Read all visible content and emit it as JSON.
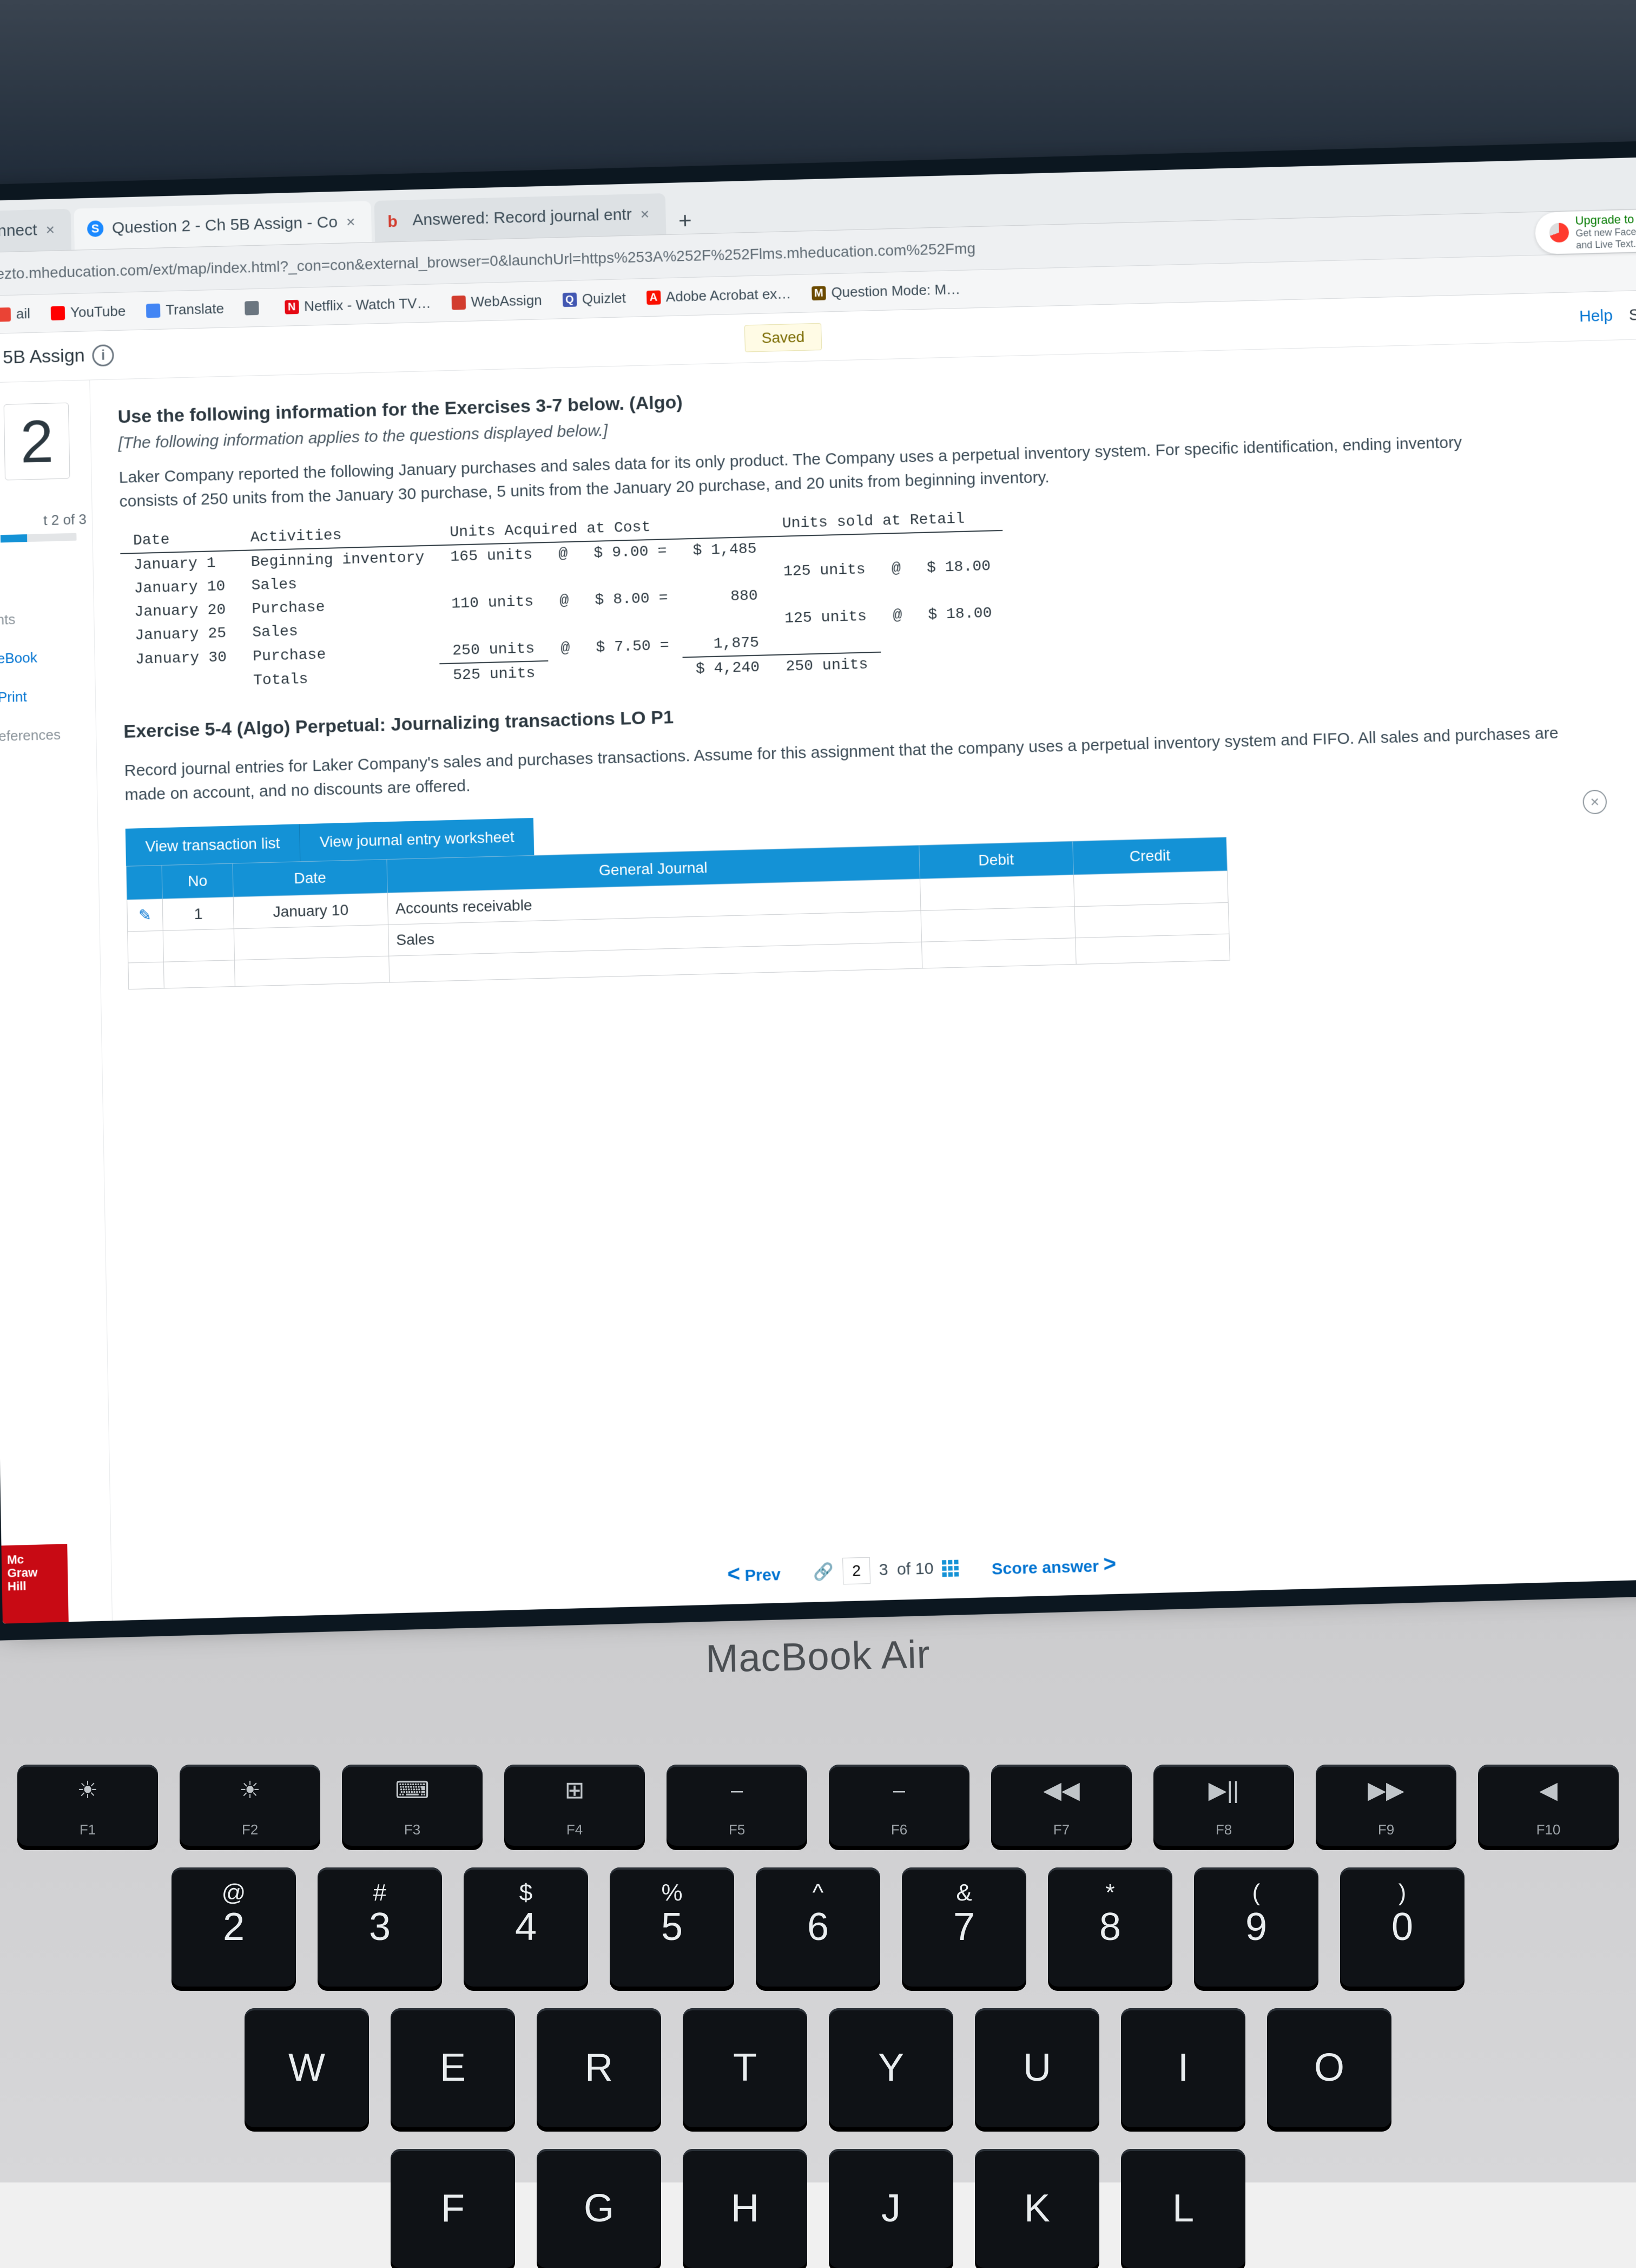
{
  "tabs": [
    {
      "label": "nnect",
      "active": false
    },
    {
      "label": "Question 2 - Ch 5B Assign - Co",
      "active": true,
      "fav": "S"
    },
    {
      "label": "Answered: Record journal entr",
      "active": false,
      "fav": "b"
    }
  ],
  "url": "ezto.mheducation.com/ext/map/index.html?_con=con&external_browser=0&launchUrl=https%253A%252F%252Flms.mheducation.com%252Fmg",
  "upgrade": {
    "title": "Upgrade to ma",
    "line1": "Get new FaceTim",
    "line2": "and Live Text."
  },
  "bookmarks": [
    {
      "label": "ail",
      "color": "#ea4335"
    },
    {
      "label": "YouTube",
      "color": "#ff0000"
    },
    {
      "label": "Translate",
      "color": "#4285f4"
    },
    {
      "label": "",
      "color": "#6b7680"
    },
    {
      "label": "Netflix - Watch TV…",
      "color": "#e50914",
      "prefix": "N"
    },
    {
      "label": "WebAssign",
      "color": "#d23c2e"
    },
    {
      "label": "Quizlet",
      "color": "#4257b2",
      "prefix": "Q"
    },
    {
      "label": "Adobe Acrobat ex…",
      "color": "#fa0f00",
      "prefix": "A"
    },
    {
      "label": "Question Mode: M…",
      "color": "#6b4a00",
      "prefix": "M"
    }
  ],
  "assign": {
    "title": "5B Assign",
    "saved": "Saved",
    "help": "Help",
    "save": "Save"
  },
  "qnum": "2",
  "part": "t 2 of 3",
  "sideLinks": [
    "nts",
    "eBook",
    "Print",
    "eferences"
  ],
  "intro": {
    "head": "Use the following information for the Exercises 3-7 below. (Algo)",
    "italic": "[The following information applies to the questions displayed below.]",
    "body": "Laker Company reported the following January purchases and sales data for its only product. The Company uses a perpetual inventory system. For specific identification, ending inventory consists of 250 units from the January 30 purchase, 5 units from the January 20 purchase, and 20 units from beginning inventory."
  },
  "dataHeaders": {
    "date": "Date",
    "act": "Activities",
    "uac": "Units Acquired at Cost",
    "usr": "Units sold at Retail"
  },
  "dataRows": [
    {
      "date": "January 1",
      "act": "Beginning inventory",
      "units": "165 units",
      "at": "@",
      "price": "$ 9.00 =",
      "ext": "$ 1,485",
      "sold": "",
      "sat": "",
      "sprice": ""
    },
    {
      "date": "January 10",
      "act": "Sales",
      "units": "",
      "at": "",
      "price": "",
      "ext": "",
      "sold": "125 units",
      "sat": "@",
      "sprice": "$ 18.00"
    },
    {
      "date": "January 20",
      "act": "Purchase",
      "units": "110 units",
      "at": "@",
      "price": "$ 8.00 =",
      "ext": "880",
      "sold": "",
      "sat": "",
      "sprice": ""
    },
    {
      "date": "January 25",
      "act": "Sales",
      "units": "",
      "at": "",
      "price": "",
      "ext": "",
      "sold": "125 units",
      "sat": "@",
      "sprice": "$ 18.00"
    },
    {
      "date": "January 30",
      "act": "Purchase",
      "units": "250 units",
      "at": "@",
      "price": "$ 7.50 =",
      "ext": "1,875",
      "sold": "",
      "sat": "",
      "sprice": ""
    }
  ],
  "totalsRow": {
    "date": "",
    "act": "Totals",
    "units": "525 units",
    "at": "",
    "price": "",
    "ext": "$ 4,240",
    "sold": "250 units",
    "sat": "",
    "sprice": ""
  },
  "exercise": {
    "head": "Exercise 5-4 (Algo) Perpetual: Journalizing transactions LO P1",
    "body": "Record journal entries for Laker Company's sales and purchases transactions. Assume for this assignment that the company uses a perpetual inventory system and FIFO. All sales and purchases are made on account, and no discounts are offered."
  },
  "viewBtns": {
    "a": "View transaction list",
    "b": "View journal entry worksheet"
  },
  "journal": {
    "headers": {
      "no": "No",
      "date": "Date",
      "gj": "General Journal",
      "debit": "Debit",
      "credit": "Credit"
    },
    "rows": [
      {
        "no": "1",
        "date": "January 10",
        "acct": "Accounts receivable",
        "debit": "",
        "credit": ""
      },
      {
        "no": "",
        "date": "",
        "acct": "Sales",
        "debit": "",
        "credit": ""
      },
      {
        "no": "",
        "date": "",
        "acct": "",
        "debit": "",
        "credit": ""
      }
    ]
  },
  "footer": {
    "prev": "Prev",
    "cur": "2",
    "fixed": "3",
    "of": "of 10",
    "next": "Score answer"
  },
  "logo": {
    "a": "Mc",
    "b": "Graw",
    "c": "Hill"
  },
  "bezel": "MacBook Air",
  "fnRow": [
    "F1",
    "F2",
    "F3",
    "F4",
    "F5",
    "F6",
    "F7",
    "F8",
    "F9",
    "F10"
  ],
  "fnSym": [
    "☀",
    "☀",
    "⌨",
    "⊞",
    "⎯",
    "⎯",
    "◀◀",
    "▶||",
    "▶▶",
    "◀"
  ],
  "numRow": [
    {
      "top": "@",
      "main": "2"
    },
    {
      "top": "#",
      "main": "3"
    },
    {
      "top": "$",
      "main": "4"
    },
    {
      "top": "%",
      "main": "5"
    },
    {
      "top": "^",
      "main": "6"
    },
    {
      "top": "&",
      "main": "7"
    },
    {
      "top": "*",
      "main": "8"
    },
    {
      "top": "(",
      "main": "9"
    },
    {
      "top": ")",
      "main": "0"
    }
  ],
  "letRow1": [
    "W",
    "E",
    "R",
    "T",
    "Y",
    "U",
    "I",
    "O"
  ],
  "letRow2": [
    "F",
    "G",
    "H",
    "J",
    "K",
    "L"
  ]
}
